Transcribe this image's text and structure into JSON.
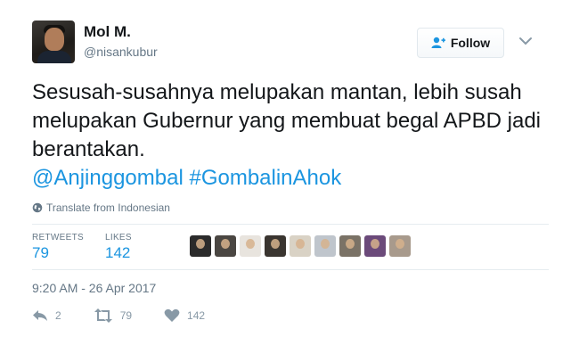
{
  "author": {
    "name": "Mol M.",
    "handle": "@nisankubur"
  },
  "follow_button": {
    "label": "Follow",
    "icon": "follow-user-icon"
  },
  "tweet": {
    "text_plain": "Sesusah-susahnya melupakan mantan, lebih susah melupakan Gubernur yang membuat begal APBD jadi berantakan.",
    "mention": "@Anjinggombal",
    "hashtag": "#GombalinAhok"
  },
  "translate": {
    "label": "Translate from Indonesian",
    "icon": "globe-icon"
  },
  "stats": {
    "retweets_label": "RETWEETS",
    "retweets_value": "79",
    "likes_label": "LIKES",
    "likes_value": "142"
  },
  "liker_avatars": [
    {
      "color": "#2b2b2b"
    },
    {
      "color": "#4a4642"
    },
    {
      "color": "#e8e4de"
    },
    {
      "color": "#3a3530"
    },
    {
      "color": "#d9d2c5"
    },
    {
      "color": "#bfc5cc"
    },
    {
      "color": "#7a7266"
    },
    {
      "color": "#6b4a7a"
    },
    {
      "color": "#a89a8c"
    }
  ],
  "timestamp": "9:20 AM - 26 Apr 2017",
  "actions": {
    "reply_count": "2",
    "retweet_count": "79",
    "like_count": "142"
  },
  "colors": {
    "link": "#1b95e0",
    "muted": "#657786",
    "action_icon": "#8899a6"
  }
}
